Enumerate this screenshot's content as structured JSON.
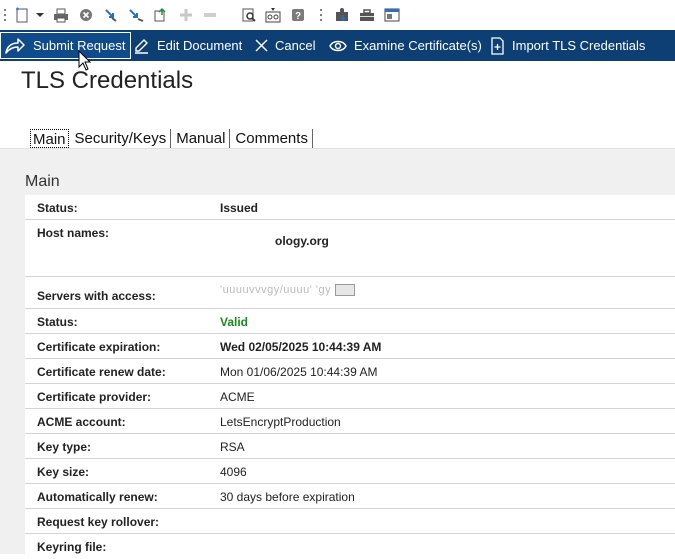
{
  "toolbar_icons": [
    "new-document-icon",
    "dropdown-arrow-icon",
    "print-icon",
    "close-circle-icon",
    "download-icon",
    "upload-icon",
    "copy-icon",
    "add-icon",
    "remove-icon",
    "find-icon",
    "binoculars-icon",
    "help-icon",
    "puzzle-icon",
    "toolbox-icon",
    "window-icon"
  ],
  "actions": {
    "submit_request": "Submit Request",
    "edit_document": "Edit Document",
    "cancel": "Cancel",
    "examine_certificates": "Examine Certificate(s)",
    "import_tls": "Import TLS Credentials"
  },
  "page_title": "TLS Credentials",
  "tabs": [
    "Main",
    "Security/Keys",
    "Manual",
    "Comments"
  ],
  "section_title": "Main",
  "fields": {
    "status": {
      "label": "Status:",
      "value": "Issued"
    },
    "host_names": {
      "label": "Host names:",
      "value": "ology.org"
    },
    "servers": {
      "label": "Servers with access:",
      "value": "'uuuuvvvgy/uuuu'  'gy"
    },
    "status2": {
      "label": "Status:",
      "value": "Valid"
    },
    "expiration": {
      "label": "Certificate expiration:",
      "value": "Wed 02/05/2025 10:44:39 AM"
    },
    "renew_date": {
      "label": "Certificate renew date:",
      "value": "Mon 01/06/2025 10:44:39 AM"
    },
    "provider": {
      "label": "Certificate provider:",
      "value": "ACME"
    },
    "acme_account": {
      "label": "ACME account:",
      "value": "LetsEncryptProduction"
    },
    "key_type": {
      "label": "Key type:",
      "value": "RSA"
    },
    "key_size": {
      "label": "Key size:",
      "value": "4096"
    },
    "auto_renew": {
      "label": "Automatically renew:",
      "value": "30 days before expiration"
    },
    "key_rollover": {
      "label": "Request key rollover:",
      "value": ""
    },
    "keyring": {
      "label": "Keyring file:",
      "value": ""
    }
  },
  "colors": {
    "action_bar": "#0d3e74",
    "valid_green": "#1a8a1a",
    "panel_grey": "#f0f0f0"
  }
}
